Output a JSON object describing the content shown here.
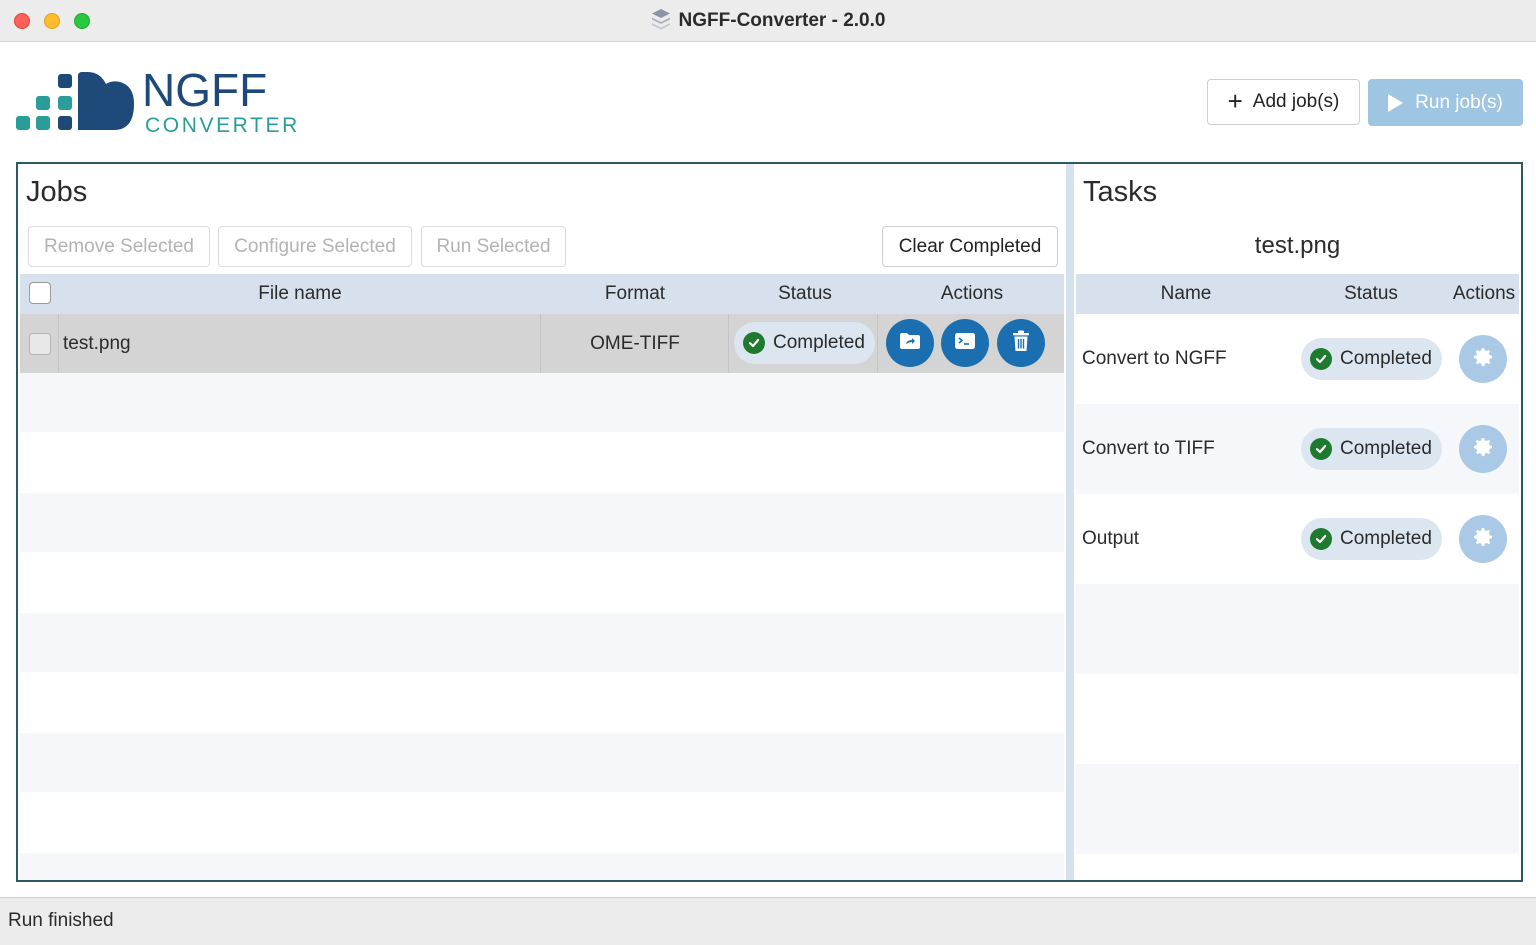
{
  "window": {
    "title": "NGFF-Converter - 2.0.0",
    "icon": "stacked-layers-icon"
  },
  "logo": {
    "main": "NGFF",
    "sub": "CONVERTER",
    "colors": {
      "navy": "#1d4a78",
      "teal": "#2a9d9a"
    }
  },
  "header": {
    "add_label": "Add job(s)",
    "run_label": "Run job(s)",
    "run_enabled": false
  },
  "jobs": {
    "title": "Jobs",
    "toolbar": {
      "remove_label": "Remove Selected",
      "configure_label": "Configure Selected",
      "run_label": "Run Selected",
      "clear_label": "Clear Completed"
    },
    "columns": {
      "file_name": "File name",
      "format": "Format",
      "status": "Status",
      "actions": "Actions"
    },
    "rows": [
      {
        "file_name": "test.png",
        "format": "OME-TIFF",
        "status": "Completed",
        "selected": true,
        "actions": [
          "open-folder-icon",
          "terminal-icon",
          "trash-icon"
        ]
      }
    ]
  },
  "tasks": {
    "title": "Tasks",
    "subtitle": "test.png",
    "columns": {
      "name": "Name",
      "status": "Status",
      "actions": "Actions"
    },
    "rows": [
      {
        "name": "Convert to NGFF",
        "status": "Completed",
        "action": "gear-icon"
      },
      {
        "name": "Convert to TIFF",
        "status": "Completed",
        "action": "gear-icon"
      },
      {
        "name": "Output",
        "status": "Completed",
        "action": "gear-icon"
      }
    ]
  },
  "statusbar": {
    "text": "Run finished"
  },
  "colors": {
    "accent": "#1b6fb0",
    "success": "#1e7a2e",
    "header_bg": "#d7e1ee",
    "frame_border": "#2b5a66",
    "run_disabled": "#9ec6e3"
  }
}
